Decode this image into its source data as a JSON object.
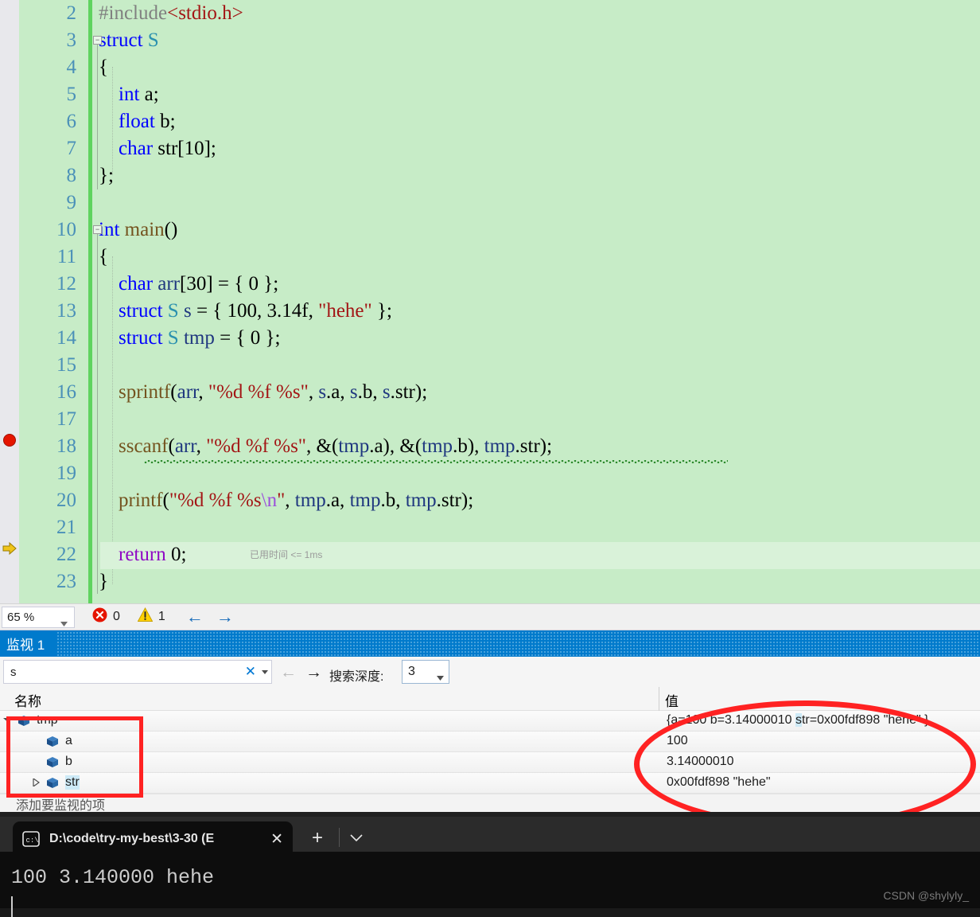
{
  "editor": {
    "language": "c",
    "zoom_level": "65 %",
    "background_color": "#c7ecc7",
    "first_visible_line": 2,
    "breakpoint_line": 18,
    "current_statement_line": 22,
    "elapsed_annotation": "已用时间 <= 1ms",
    "lines": [
      {
        "n": "2",
        "tokens": [
          {
            "t": "#include",
            "c": "c-pre"
          },
          {
            "t": "<stdio.h>",
            "c": "c-str"
          }
        ]
      },
      {
        "n": "3",
        "tokens": [
          {
            "t": "struct",
            "c": "c-kw"
          },
          {
            "t": " ",
            "c": "c-plain"
          },
          {
            "t": "S",
            "c": "c-type"
          }
        ]
      },
      {
        "n": "4",
        "tokens": [
          {
            "t": "{",
            "c": "c-plain"
          }
        ]
      },
      {
        "n": "5",
        "tokens": [
          {
            "t": "    ",
            "c": "c-plain"
          },
          {
            "t": "int",
            "c": "c-kw"
          },
          {
            "t": " a;",
            "c": "c-plain"
          }
        ]
      },
      {
        "n": "6",
        "tokens": [
          {
            "t": "    ",
            "c": "c-plain"
          },
          {
            "t": "float",
            "c": "c-kw"
          },
          {
            "t": " b;",
            "c": "c-plain"
          }
        ]
      },
      {
        "n": "7",
        "tokens": [
          {
            "t": "    ",
            "c": "c-plain"
          },
          {
            "t": "char",
            "c": "c-kw"
          },
          {
            "t": " str[10];",
            "c": "c-plain"
          }
        ]
      },
      {
        "n": "8",
        "tokens": [
          {
            "t": "};",
            "c": "c-plain"
          }
        ]
      },
      {
        "n": "9",
        "tokens": []
      },
      {
        "n": "10",
        "tokens": [
          {
            "t": "int",
            "c": "c-kw"
          },
          {
            "t": " ",
            "c": "c-plain"
          },
          {
            "t": "main",
            "c": "c-fn"
          },
          {
            "t": "()",
            "c": "c-plain"
          }
        ]
      },
      {
        "n": "11",
        "tokens": [
          {
            "t": "{",
            "c": "c-plain"
          }
        ]
      },
      {
        "n": "12",
        "tokens": [
          {
            "t": "    ",
            "c": "c-plain"
          },
          {
            "t": "char",
            "c": "c-kw"
          },
          {
            "t": " ",
            "c": "c-plain"
          },
          {
            "t": "arr",
            "c": "c-var"
          },
          {
            "t": "[30] = { 0 };",
            "c": "c-plain"
          }
        ]
      },
      {
        "n": "13",
        "tokens": [
          {
            "t": "    ",
            "c": "c-plain"
          },
          {
            "t": "struct",
            "c": "c-kw"
          },
          {
            "t": " ",
            "c": "c-plain"
          },
          {
            "t": "S",
            "c": "c-type"
          },
          {
            "t": " ",
            "c": "c-plain"
          },
          {
            "t": "s",
            "c": "c-var"
          },
          {
            "t": " = { 100, 3.14f, ",
            "c": "c-plain"
          },
          {
            "t": "\"hehe\"",
            "c": "c-str"
          },
          {
            "t": " };",
            "c": "c-plain"
          }
        ]
      },
      {
        "n": "14",
        "tokens": [
          {
            "t": "    ",
            "c": "c-plain"
          },
          {
            "t": "struct",
            "c": "c-kw"
          },
          {
            "t": " ",
            "c": "c-plain"
          },
          {
            "t": "S",
            "c": "c-type"
          },
          {
            "t": " ",
            "c": "c-plain"
          },
          {
            "t": "tmp",
            "c": "c-var"
          },
          {
            "t": " = { 0 };",
            "c": "c-plain"
          }
        ]
      },
      {
        "n": "15",
        "tokens": []
      },
      {
        "n": "16",
        "tokens": [
          {
            "t": "    ",
            "c": "c-plain"
          },
          {
            "t": "sprintf",
            "c": "c-fn"
          },
          {
            "t": "(",
            "c": "c-plain"
          },
          {
            "t": "arr",
            "c": "c-var"
          },
          {
            "t": ", ",
            "c": "c-plain"
          },
          {
            "t": "\"%d %f %s\"",
            "c": "c-str"
          },
          {
            "t": ", ",
            "c": "c-plain"
          },
          {
            "t": "s",
            "c": "c-var"
          },
          {
            "t": ".a, ",
            "c": "c-plain"
          },
          {
            "t": "s",
            "c": "c-var"
          },
          {
            "t": ".b, ",
            "c": "c-plain"
          },
          {
            "t": "s",
            "c": "c-var"
          },
          {
            "t": ".str);",
            "c": "c-plain"
          }
        ]
      },
      {
        "n": "17",
        "tokens": []
      },
      {
        "n": "18",
        "tokens": [
          {
            "t": "    ",
            "c": "c-plain"
          },
          {
            "t": "sscanf",
            "c": "c-fn"
          },
          {
            "t": "(",
            "c": "c-plain"
          },
          {
            "t": "arr",
            "c": "c-var"
          },
          {
            "t": ", ",
            "c": "c-plain"
          },
          {
            "t": "\"%d %f %s\"",
            "c": "c-str"
          },
          {
            "t": ", &(",
            "c": "c-plain"
          },
          {
            "t": "tmp",
            "c": "c-var"
          },
          {
            "t": ".a), &(",
            "c": "c-plain"
          },
          {
            "t": "tmp",
            "c": "c-var"
          },
          {
            "t": ".b), ",
            "c": "c-plain"
          },
          {
            "t": "tmp",
            "c": "c-var"
          },
          {
            "t": ".str);",
            "c": "c-plain"
          }
        ]
      },
      {
        "n": "19",
        "tokens": []
      },
      {
        "n": "20",
        "tokens": [
          {
            "t": "    ",
            "c": "c-plain"
          },
          {
            "t": "printf",
            "c": "c-fn"
          },
          {
            "t": "(",
            "c": "c-plain"
          },
          {
            "t": "\"%d %f %s",
            "c": "c-str"
          },
          {
            "t": "\\n",
            "c": "c-esc"
          },
          {
            "t": "\"",
            "c": "c-str"
          },
          {
            "t": ", ",
            "c": "c-plain"
          },
          {
            "t": "tmp",
            "c": "c-var"
          },
          {
            "t": ".a, ",
            "c": "c-plain"
          },
          {
            "t": "tmp",
            "c": "c-var"
          },
          {
            "t": ".b, ",
            "c": "c-plain"
          },
          {
            "t": "tmp",
            "c": "c-var"
          },
          {
            "t": ".str);",
            "c": "c-plain"
          }
        ]
      },
      {
        "n": "21",
        "tokens": []
      },
      {
        "n": "22",
        "tokens": [
          {
            "t": "    ",
            "c": "c-plain"
          },
          {
            "t": "return",
            "c": "c-ctl"
          },
          {
            "t": " 0;",
            "c": "c-plain"
          }
        ]
      },
      {
        "n": "23",
        "tokens": [
          {
            "t": "}",
            "c": "c-plain"
          }
        ]
      }
    ]
  },
  "statusbar": {
    "zoom_value": "65 %",
    "error_count": "0",
    "warning_count": "1",
    "back_arrow": "←",
    "forward_arrow": "→"
  },
  "watch": {
    "title": "监视 1",
    "search_value": "s",
    "search_clear_glyph": "✕",
    "back_arrow": "←",
    "forward_arrow": "→",
    "depth_label": "搜索深度:",
    "depth_value": "3",
    "columns": {
      "name": "名称",
      "value": "值"
    },
    "rows": [
      {
        "name": "tmp",
        "value": "{a=100 b=3.14000010 str=0x00fdf898 \"hehe\" }",
        "indent": 22,
        "expander": "expanded",
        "depth": 0
      },
      {
        "name": "a",
        "value": "100",
        "indent": 58,
        "expander": "none",
        "depth": 1
      },
      {
        "name": "b",
        "value": "3.14000010",
        "indent": 58,
        "expander": "none",
        "depth": 1
      },
      {
        "name": "str",
        "value": "0x00fdf898 \"hehe\"",
        "indent": 58,
        "expander": "collapsed",
        "depth": 1
      }
    ],
    "add_item_placeholder": "添加要监视的项"
  },
  "terminal": {
    "tab_title": "D:\\code\\try-my-best\\3-30 (E",
    "tab_close_glyph": "✕",
    "new_tab_glyph": "+",
    "dropdown_glyph": "⌄",
    "output": "100 3.140000 hehe"
  },
  "watermark": "CSDN @shylyly_",
  "annotations": {
    "colors": {
      "highlight_red": "#ff2222",
      "accent_blue": "#007acc",
      "change_bar_green": "#5fd35f"
    }
  }
}
